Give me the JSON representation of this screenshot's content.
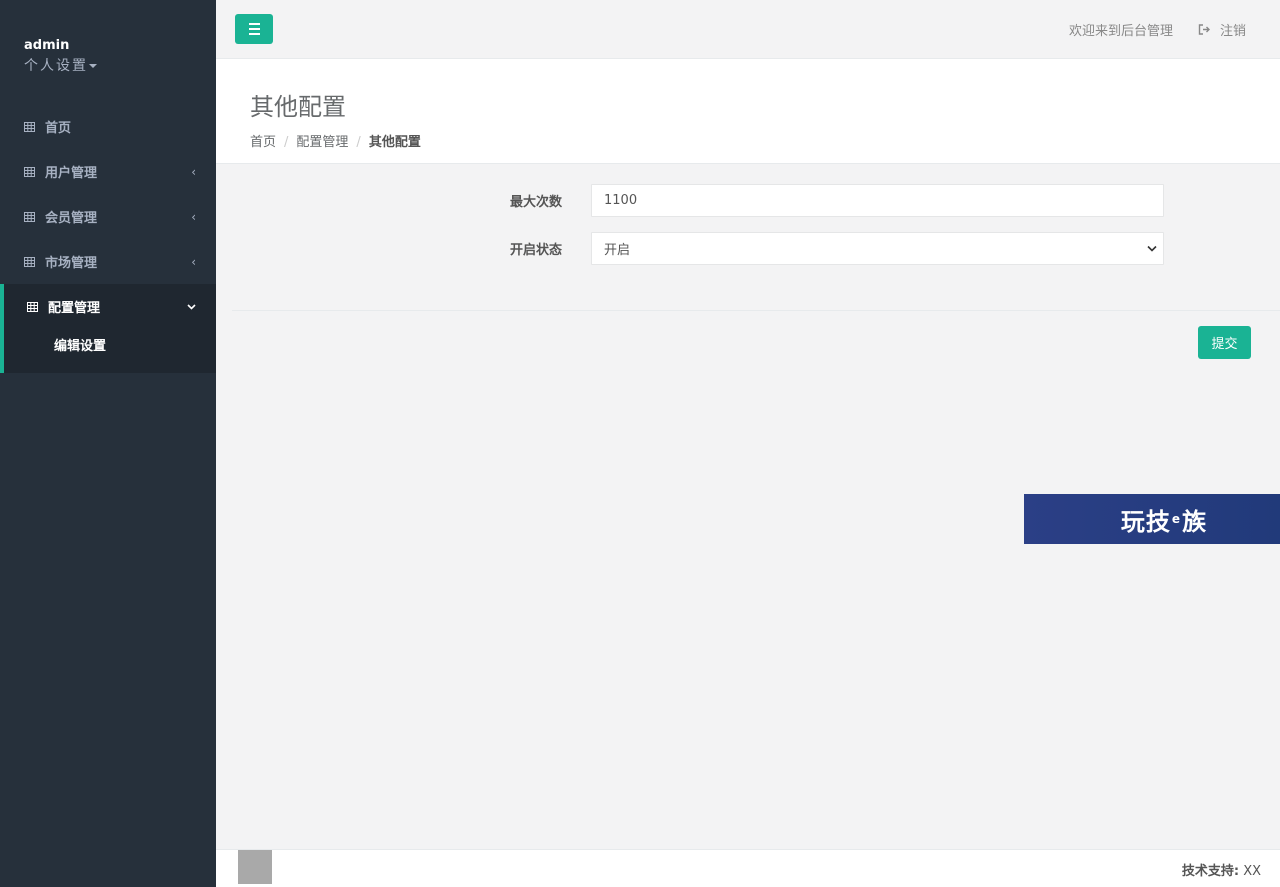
{
  "profile": {
    "name": "admin",
    "settings_label": "个人设置"
  },
  "sidebar": {
    "items": [
      {
        "label": "首页",
        "icon": "grid-icon",
        "has_arrow": false
      },
      {
        "label": "用户管理",
        "icon": "grid-icon",
        "arrow": "‹"
      },
      {
        "label": "会员管理",
        "icon": "grid-icon",
        "arrow": "‹"
      },
      {
        "label": "市场管理",
        "icon": "grid-icon",
        "arrow": "‹"
      },
      {
        "label": "配置管理",
        "icon": "grid-icon",
        "arrow": "chevron-down",
        "active": true
      }
    ],
    "sub_items": [
      {
        "label": "编辑设置"
      }
    ]
  },
  "topbar": {
    "menu_icon": "hamburger-icon",
    "welcome": "欢迎来到后台管理",
    "logout_label": "注销",
    "logout_icon": "sign-out-icon"
  },
  "page": {
    "title": "其他配置",
    "breadcrumb": [
      "首页",
      "配置管理",
      "其他配置"
    ]
  },
  "form": {
    "max_count_label": "最大次数",
    "max_count_value": "1100",
    "status_label": "开启状态",
    "status_value": "开启",
    "submit_label": "提交"
  },
  "banner": {
    "text_a": "玩技",
    "text_b": "e",
    "text_c": "族"
  },
  "footer": {
    "support_label": "技术支持:",
    "support_value": "XX"
  },
  "colors": {
    "accent": "#1ab394",
    "sidebar_bg": "#26303b",
    "sidebar_active_bg": "#1f2730",
    "banner_bg": "#2b3f86"
  }
}
